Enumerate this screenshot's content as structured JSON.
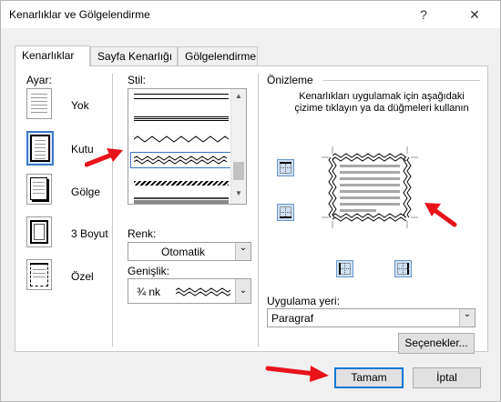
{
  "window": {
    "title": "Kenarlıklar ve Gölgelendirme",
    "help": "?",
    "close": "✕"
  },
  "tabs": [
    {
      "label": "Kenarlıklar"
    },
    {
      "label": "Sayfa Kenarlığı"
    },
    {
      "label": "Gölgelendirme"
    }
  ],
  "settings": {
    "heading": "Ayar:",
    "items": [
      {
        "label": "Yok"
      },
      {
        "label": "Kutu"
      },
      {
        "label": "Gölge"
      },
      {
        "label": "3 Boyut"
      },
      {
        "label": "Özel"
      }
    ],
    "selected": "Kutu"
  },
  "style": {
    "heading": "Stil:",
    "selected": "wavy"
  },
  "color": {
    "label": "Renk:",
    "value": "Otomatik"
  },
  "width": {
    "label": "Genişlik:",
    "value": "¾ nk"
  },
  "preview": {
    "heading": "Önizleme",
    "instruction": "Kenarlıkları uygulamak için aşağıdaki çizime tıklayın ya da düğmeleri kullanın"
  },
  "apply_to": {
    "label": "Uygulama yeri:",
    "value": "Paragraf"
  },
  "buttons": {
    "options": "Seçenekler...",
    "ok": "Tamam",
    "cancel": "İptal"
  },
  "colors": {
    "accent": "#0078d7",
    "annotation_arrow": "#e8131b"
  }
}
